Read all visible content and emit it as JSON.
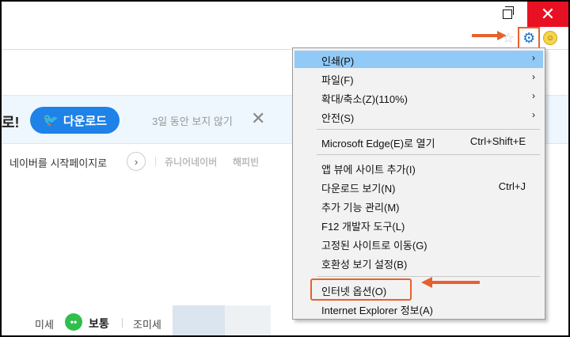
{
  "window": {
    "close_glyph": "✕"
  },
  "banner": {
    "partial_text": "로!",
    "download_label": "다운로드",
    "hide_label": "3일 동안 보지 않기",
    "close_glyph": "✕"
  },
  "nav": {
    "set_home_label": "네이버를 시작페이지로",
    "next_glyph": "›",
    "junior_label": "쥬니어네이버",
    "happybean_label": "해피빈"
  },
  "dust": {
    "pm10_label": "미세",
    "face_glyph": "••",
    "status": "보통",
    "pm25_label": "조미세"
  },
  "menu": {
    "items": [
      {
        "label": "인쇄(P)",
        "shortcut": "",
        "submenu": true
      },
      {
        "label": "파일(F)",
        "shortcut": "",
        "submenu": true
      },
      {
        "label": "확대/축소(Z)(110%)",
        "shortcut": "",
        "submenu": true
      },
      {
        "label": "안전(S)",
        "shortcut": "",
        "submenu": true
      },
      {
        "label": "Microsoft Edge(E)로 열기",
        "shortcut": "Ctrl+Shift+E",
        "submenu": false
      },
      {
        "label": "앱 뷰에 사이트 추가(I)",
        "shortcut": "",
        "submenu": false
      },
      {
        "label": "다운로드 보기(N)",
        "shortcut": "Ctrl+J",
        "submenu": false
      },
      {
        "label": "추가 기능 관리(M)",
        "shortcut": "",
        "submenu": false
      },
      {
        "label": "F12 개발자 도구(L)",
        "shortcut": "",
        "submenu": false
      },
      {
        "label": "고정된 사이트로 이동(G)",
        "shortcut": "",
        "submenu": false
      },
      {
        "label": "호환성 보기 설정(B)",
        "shortcut": "",
        "submenu": false
      },
      {
        "label": "인터넷 옵션(O)",
        "shortcut": "",
        "submenu": false
      },
      {
        "label": "Internet Explorer 정보(A)",
        "shortcut": "",
        "submenu": false
      }
    ],
    "submenu_glyph": "›"
  },
  "colors": {
    "annotation": "#e6622c",
    "highlight": "#91c9f7",
    "close": "#e81123"
  }
}
